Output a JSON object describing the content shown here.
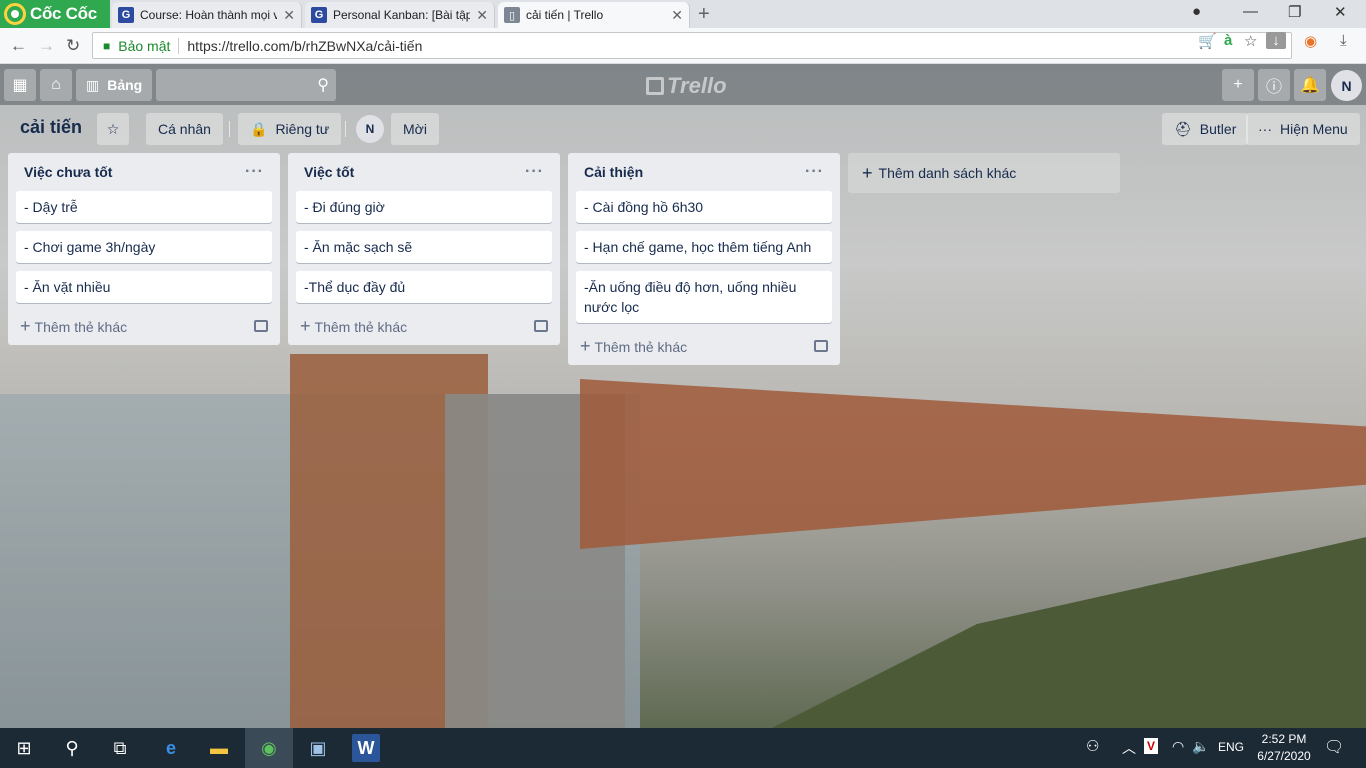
{
  "browser": {
    "brand": "Cốc Cốc",
    "tabs": [
      {
        "title": "Course: Hoàn thành mọi v",
        "favicon": "G"
      },
      {
        "title": "Personal Kanban: [Bài tập]",
        "favicon": "G"
      },
      {
        "title": "cải tiến | Trello",
        "favicon": "trello"
      }
    ],
    "secure_label": "Bảo mật",
    "url": "https://trello.com/b/rhZBwNXa/cải-tiến"
  },
  "trello": {
    "boards_label": "Bảng",
    "logo_text": "Trello",
    "avatar": "N",
    "board": {
      "name": "cải tiến",
      "team_label": "Cá nhân",
      "visibility_label": "Riêng tư",
      "member_initial": "N",
      "invite_label": "Mời",
      "butler_label": "Butler",
      "menu_label": "Hiện Menu"
    },
    "lists": [
      {
        "title": "Việc chưa tốt",
        "cards": [
          "- Dậy trễ",
          "- Chơi game 3h/ngày",
          "- Ăn vặt nhiều"
        ]
      },
      {
        "title": "Việc tốt",
        "cards": [
          "- Đi đúng giờ",
          "- Ăn mặc sạch sẽ",
          "-Thể dục đầy đủ"
        ]
      },
      {
        "title": "Cải thiện",
        "cards": [
          "- Cài đồng hồ 6h30",
          "- Hạn chế game, học thêm tiếng Anh",
          "-Ăn uống điều độ hơn, uống nhiều nước lọc"
        ]
      }
    ],
    "add_card_label": "Thêm thẻ khác",
    "add_list_label": "Thêm danh sách khác"
  },
  "taskbar": {
    "lang": "ENG",
    "time": "2:52 PM",
    "date": "6/27/2020"
  }
}
